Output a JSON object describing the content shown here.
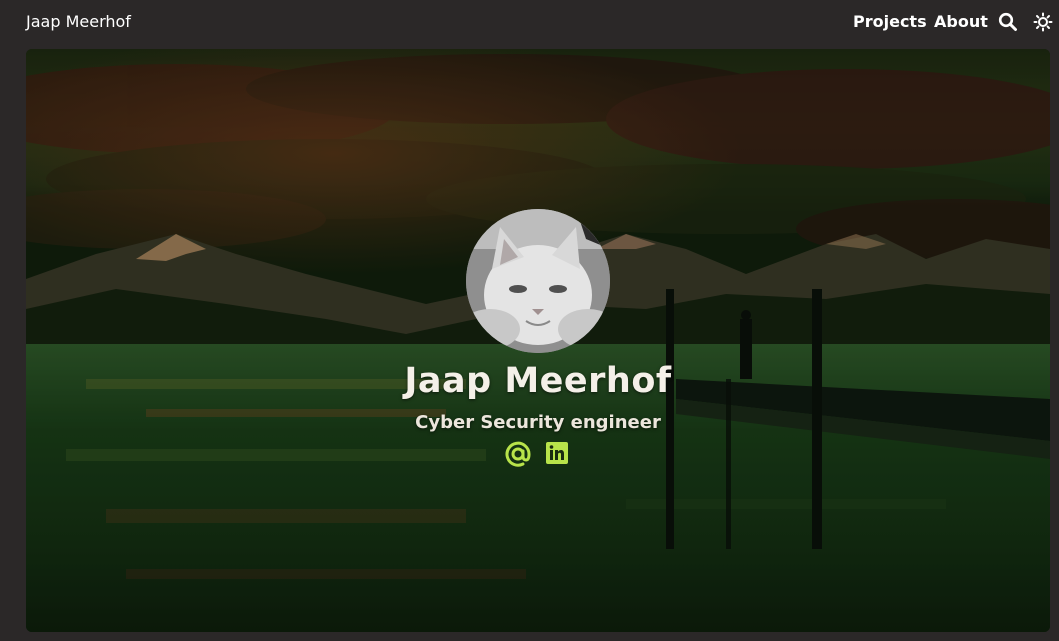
{
  "nav": {
    "brand": "Jaap Meerhof",
    "links": [
      {
        "label": "Projects"
      },
      {
        "label": "About"
      }
    ],
    "icons": [
      "search-icon",
      "theme-toggle-icon"
    ]
  },
  "hero": {
    "name": "Jaap Meerhof",
    "subtitle": "Cyber Security engineer",
    "social": [
      {
        "icon": "email-at-icon"
      },
      {
        "icon": "linkedin-icon"
      }
    ],
    "accent_color": "#b8e34a"
  },
  "colors": {
    "nav_background": "#2b2828",
    "text": "#ffffff"
  }
}
